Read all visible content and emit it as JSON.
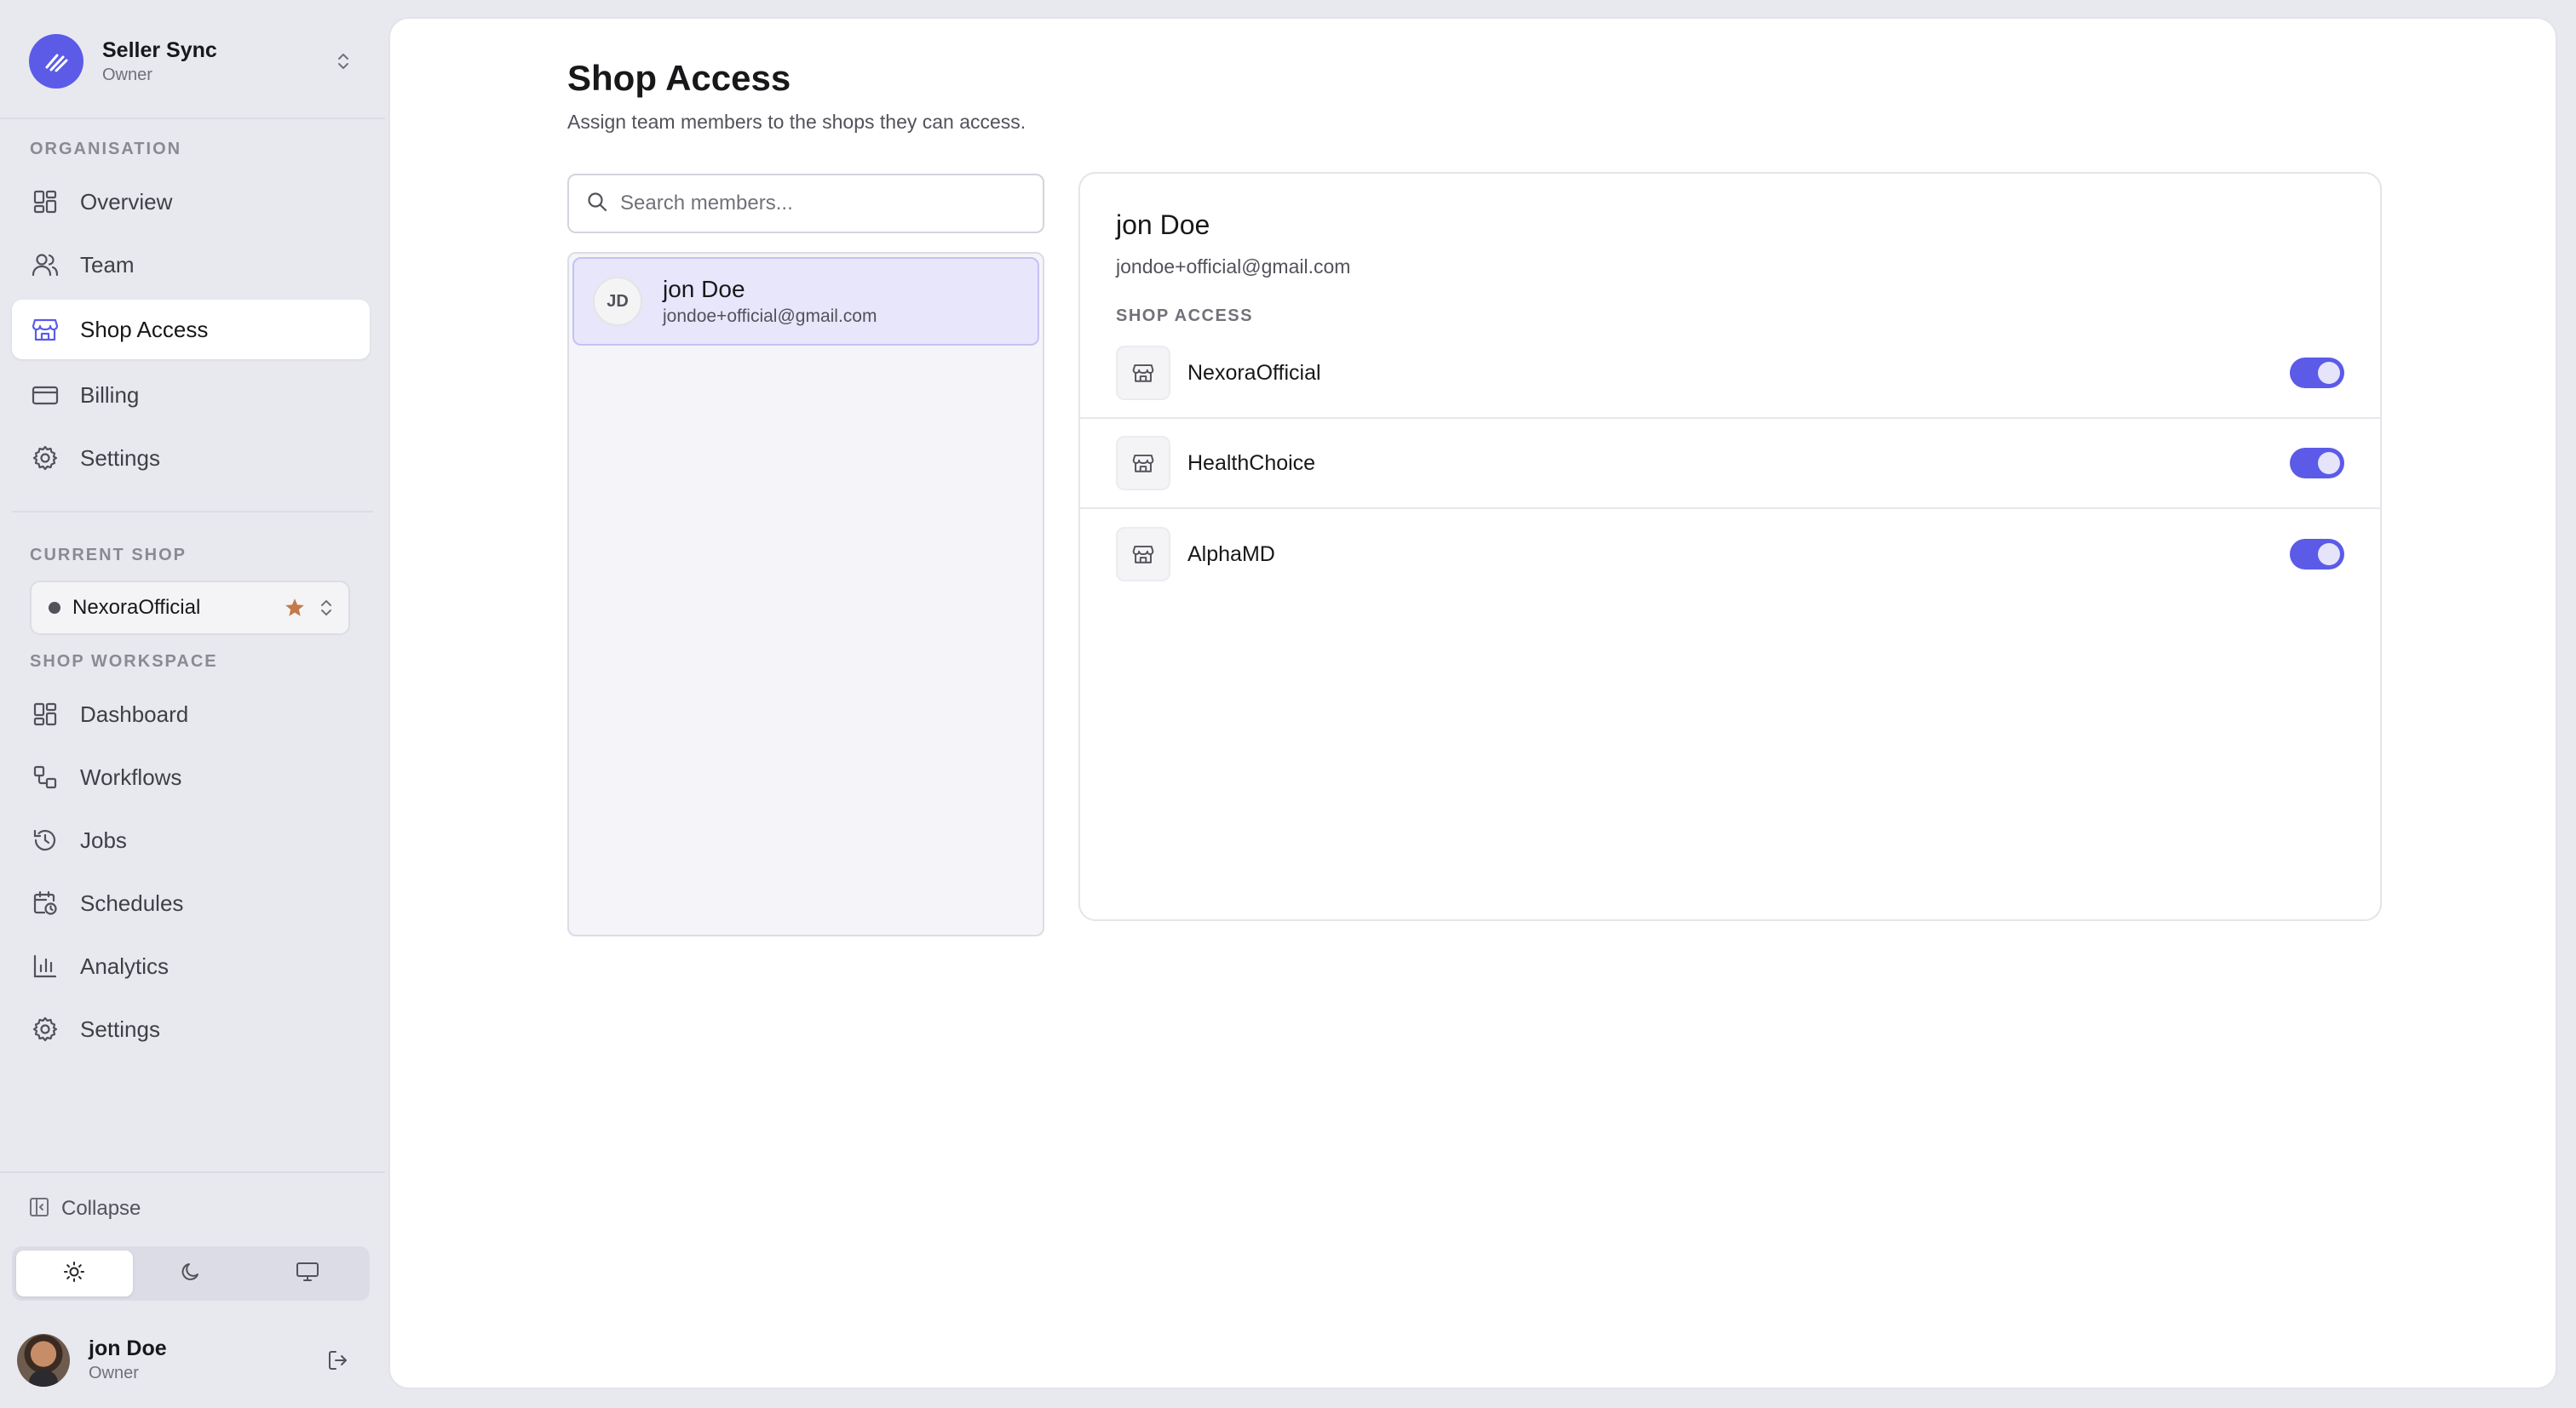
{
  "org": {
    "name": "Seller Sync",
    "role": "Owner"
  },
  "sidebar": {
    "organisation_label": "ORGANISATION",
    "org_items": [
      {
        "label": "Overview",
        "icon": "grid-icon"
      },
      {
        "label": "Team",
        "icon": "users-icon"
      },
      {
        "label": "Shop Access",
        "icon": "store-icon",
        "active": true
      },
      {
        "label": "Billing",
        "icon": "credit-card-icon"
      },
      {
        "label": "Settings",
        "icon": "gear-icon"
      }
    ],
    "current_shop_label": "CURRENT SHOP",
    "current_shop": "NexoraOfficial",
    "workspace_label": "SHOP WORKSPACE",
    "workspace_items": [
      {
        "label": "Dashboard",
        "icon": "grid-icon"
      },
      {
        "label": "Workflows",
        "icon": "workflow-icon"
      },
      {
        "label": "Jobs",
        "icon": "history-icon"
      },
      {
        "label": "Schedules",
        "icon": "calendar-clock-icon"
      },
      {
        "label": "Analytics",
        "icon": "bar-chart-icon"
      },
      {
        "label": "Settings",
        "icon": "gear-icon"
      }
    ],
    "collapse_label": "Collapse",
    "theme_options": [
      "sun-icon",
      "moon-icon",
      "monitor-icon"
    ],
    "user": {
      "name": "jon Doe",
      "role": "Owner"
    }
  },
  "main": {
    "title": "Shop Access",
    "subtitle": "Assign team members to the shops they can access.",
    "search": {
      "placeholder": "Search members...",
      "value": ""
    },
    "members": [
      {
        "initials": "JD",
        "name": "jon Doe",
        "email": "jondoe+official@gmail.com"
      }
    ],
    "detail": {
      "name": "jon Doe",
      "email": "jondoe+official@gmail.com",
      "section_label": "SHOP ACCESS",
      "shops": [
        {
          "name": "NexoraOfficial",
          "enabled": true
        },
        {
          "name": "HealthChoice",
          "enabled": true
        },
        {
          "name": "AlphaMD",
          "enabled": true
        }
      ]
    }
  },
  "colors": {
    "accent": "#5b5be8",
    "selected_bg": "#e7e6fb",
    "star": "#c27a4a"
  }
}
